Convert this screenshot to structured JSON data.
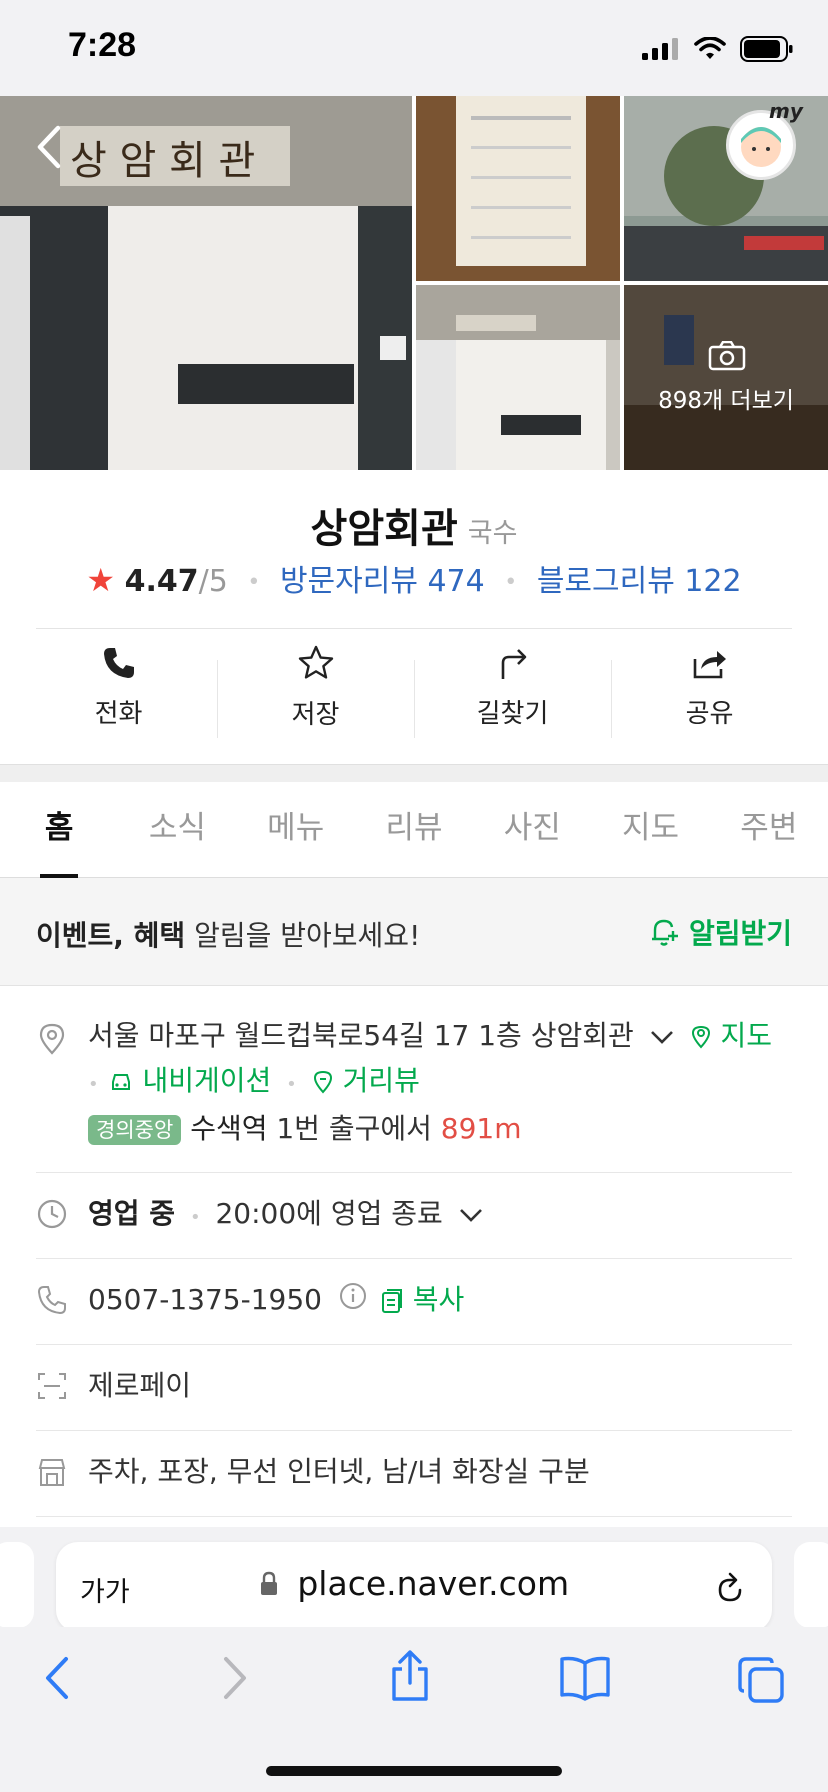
{
  "status_bar": {
    "time": "7:28"
  },
  "photos": {
    "more_label": "898개 더보기"
  },
  "place": {
    "name": "상암회관",
    "category": "국수",
    "rating": "4.47",
    "rating_max": "/5",
    "visitor_reviews": "방문자리뷰 474",
    "blog_reviews": "블로그리뷰 122"
  },
  "actions": [
    {
      "label": "전화",
      "icon": "phone-icon"
    },
    {
      "label": "저장",
      "icon": "star-icon"
    },
    {
      "label": "길찾기",
      "icon": "directions-icon"
    },
    {
      "label": "공유",
      "icon": "share-icon"
    }
  ],
  "tabs": [
    "홈",
    "소식",
    "메뉴",
    "리뷰",
    "사진",
    "지도",
    "주변"
  ],
  "alert": {
    "bold": "이벤트, 혜택",
    "text": " 알림을 받아보세요!",
    "button": "알림받기"
  },
  "info": {
    "address": "서울 마포구 월드컵북로54길 17 1층 상암회관",
    "map_link": "지도",
    "navigation": "내비게이션",
    "street_view": "거리뷰",
    "line_badge": "경의중앙",
    "station": "수색역",
    "exit_text": " 1번 출구에서 ",
    "distance": "891m",
    "open_status": "영업 중",
    "close_time": "20:00에 영업 종료",
    "phone": "0507-1375-1950",
    "copy": "복사",
    "pay": "제로페이",
    "amenities": "주차, 포장, 무선 인터넷, 남/녀 화장실 구분"
  },
  "browser": {
    "text_size": "가가",
    "url": "place.naver.com"
  },
  "colors": {
    "accent_green": "#03a94d",
    "link_blue": "#2f68bf",
    "star_red": "#f0443a"
  }
}
